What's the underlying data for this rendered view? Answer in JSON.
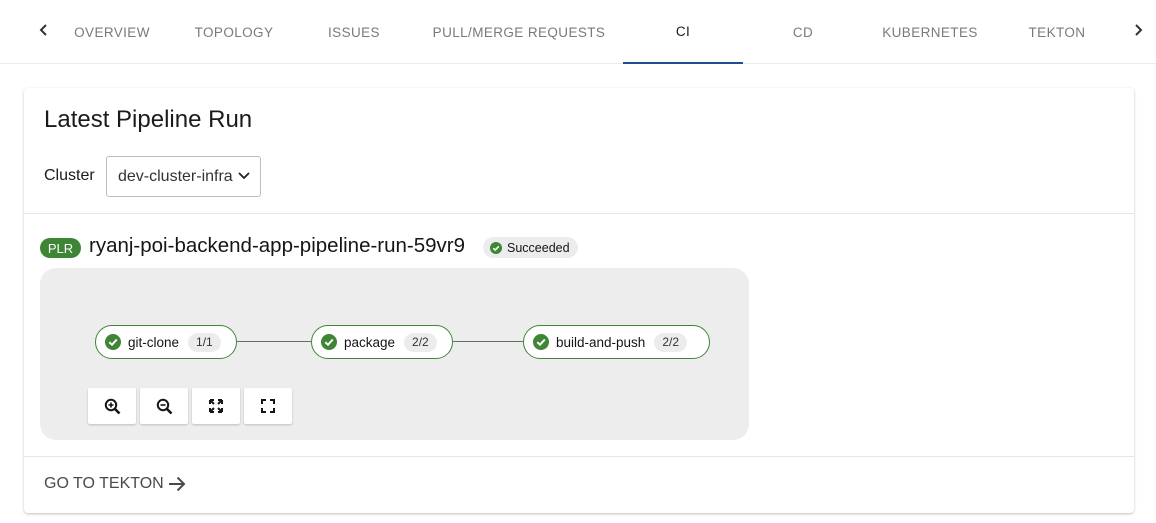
{
  "tabs": {
    "items": [
      {
        "label": "Overview",
        "active": false
      },
      {
        "label": "Topology",
        "active": false
      },
      {
        "label": "Issues",
        "active": false
      },
      {
        "label": "Pull/Merge Requests",
        "active": false
      },
      {
        "label": "CI",
        "active": true
      },
      {
        "label": "CD",
        "active": false
      },
      {
        "label": "Kubernetes",
        "active": false
      },
      {
        "label": "Tekton",
        "active": false
      }
    ],
    "scroll_left_icon": "chevron-left-icon",
    "scroll_right_icon": "chevron-right-icon",
    "active_indicator_color": "#1f4e8f"
  },
  "card": {
    "title": "Latest Pipeline Run",
    "cluster_label": "Cluster",
    "cluster_value": "dev-cluster-infra",
    "pipeline_run": {
      "badge": "PLR",
      "badge_color": "#3e8635",
      "name": "ryanj-poi-backend-app-pipeline-run-59vr9",
      "status": "Succeeded",
      "status_color": "#3e8635"
    },
    "tasks": [
      {
        "name": "git-clone",
        "steps": "1/1",
        "icon": "check-circle-icon"
      },
      {
        "name": "package",
        "steps": "2/2",
        "icon": "check-circle-icon"
      },
      {
        "name": "build-and-push",
        "steps": "2/2",
        "icon": "check-circle-icon"
      }
    ],
    "controls": [
      "zoom-in-icon",
      "zoom-out-icon",
      "fit-to-screen-icon",
      "fullscreen-icon"
    ],
    "footer_link": "GO TO TEKTON"
  }
}
